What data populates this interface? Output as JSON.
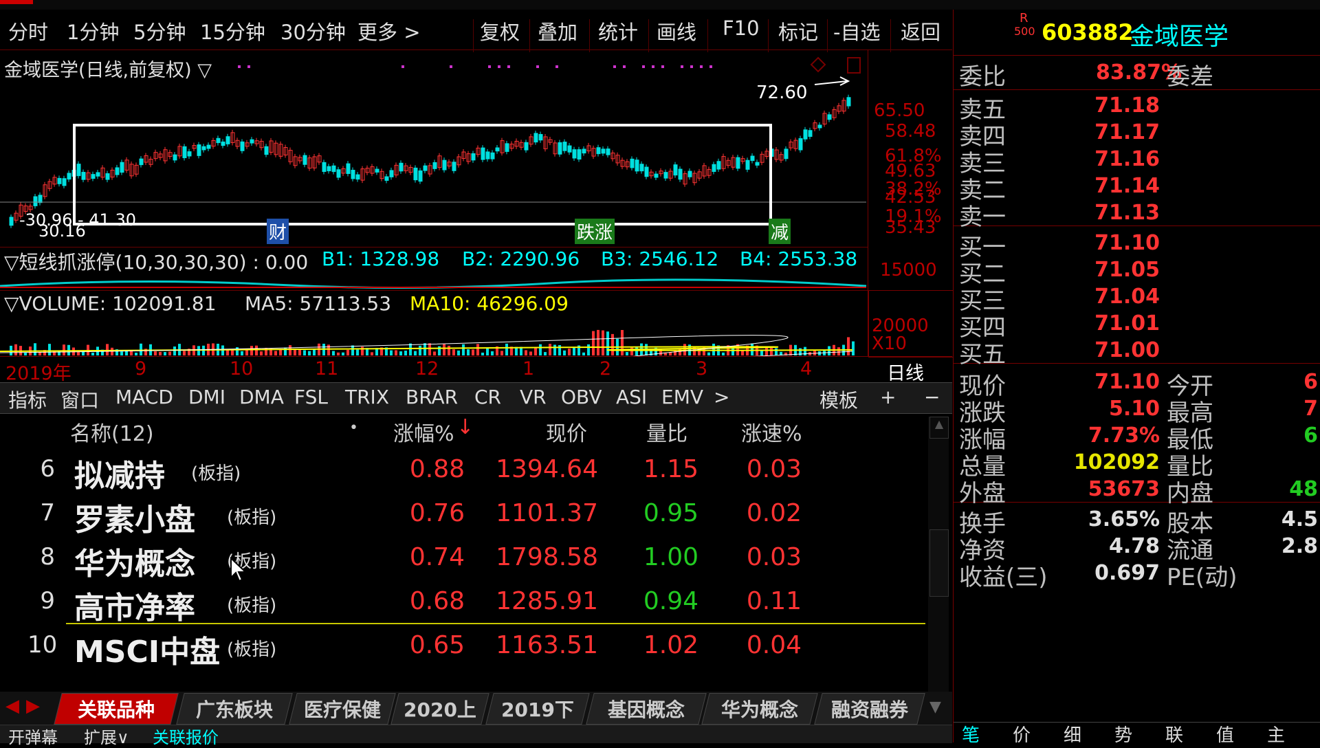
{
  "toolbar": {
    "periods": [
      "分时",
      "1分钟",
      "5分钟",
      "15分钟",
      "30分钟",
      "更多 >"
    ],
    "actions": [
      "复权",
      "叠加",
      "统计",
      "画线",
      "F10",
      "标记",
      "-自选",
      "返回"
    ]
  },
  "stock": {
    "badge_top": "R",
    "badge_bottom": "500",
    "code": "603882",
    "name": "金域医学"
  },
  "chart": {
    "title": "金域医学(日线,前复权) ▽",
    "high_label": "72.60",
    "low_label": "-30.96 - 41.30",
    "low_sub": "30.16",
    "price_axis": [
      "65.50",
      "58.48",
      "61.8%",
      "49.63",
      "38.2%",
      "42.53",
      "19.1%",
      "35.43"
    ],
    "markers": [
      {
        "text": "财",
        "color": "#1e4fa8"
      },
      {
        "text": "跌涨",
        "color": "#1a7a1a"
      },
      {
        "text": "减",
        "color": "#1a7a1a"
      }
    ]
  },
  "indicator1": {
    "name": "▽短线抓涨停(10,30,30,30) : 0.00",
    "b1": "B1: 1328.98",
    "b2": "B2: 2290.96",
    "b3": "B3: 2546.12",
    "b4": "B4: 2553.38",
    "axis": "15000"
  },
  "volume": {
    "label": "▽VOLUME: 102091.81",
    "ma5": "MA5: 57113.53",
    "ma10": "MA10: 46296.09",
    "axis": "20000",
    "axis_unit": "X10"
  },
  "date_axis": {
    "labels": [
      "2019年",
      "9",
      "10",
      "11",
      "12",
      "1",
      "2",
      "3",
      "4"
    ],
    "period": "日线"
  },
  "indicator_tabs": [
    "指标",
    "窗口",
    "MACD",
    "DMI",
    "DMA",
    "FSL",
    "TRIX",
    "BRAR",
    "CR",
    "VR",
    "OBV",
    "ASI",
    "EMV",
    ">"
  ],
  "indicator_tab_right": [
    "模板",
    "+",
    "−"
  ],
  "list": {
    "headers": {
      "name": "名称(12)",
      "dot": "•",
      "change": "涨幅%",
      "price": "现价",
      "vol_ratio": "量比",
      "speed": "涨速%"
    },
    "rows": [
      {
        "idx": "6",
        "name": "拟减持",
        "tag": "(板指)",
        "change": "0.88",
        "price": "1394.64",
        "vol_ratio": "1.15",
        "vr_color": "#ff3333",
        "speed": "0.03"
      },
      {
        "idx": "7",
        "name": "罗素小盘",
        "tag": "(板指)",
        "change": "0.76",
        "price": "1101.37",
        "vol_ratio": "0.95",
        "vr_color": "#22cc22",
        "speed": "0.02"
      },
      {
        "idx": "8",
        "name": "华为概念",
        "tag": "(板指)",
        "change": "0.74",
        "price": "1798.58",
        "vol_ratio": "1.00",
        "vr_color": "#22cc22",
        "speed": "0.03"
      },
      {
        "idx": "9",
        "name": "高市净率",
        "tag": "(板指)",
        "change": "0.68",
        "price": "1285.91",
        "vol_ratio": "0.94",
        "vr_color": "#22cc22",
        "speed": "0.11"
      },
      {
        "idx": "10",
        "name": "MSCI中盘",
        "tag": "(板指)",
        "change": "0.65",
        "price": "1163.51",
        "vol_ratio": "1.02",
        "vr_color": "#ff3333",
        "speed": "0.04"
      }
    ]
  },
  "bottom_tabs": [
    "关联品种",
    "广东板块",
    "医疗保健",
    "2020上",
    "2019下",
    "基因概念",
    "华为概念",
    "融资融券"
  ],
  "footer": {
    "items": [
      "开弹幕",
      "扩展∨",
      "关联报价"
    ]
  },
  "right_panel": {
    "weibi_label": "委比",
    "weibi_value": "83.87%",
    "weicha_label": "委差",
    "asks": [
      {
        "label": "卖五",
        "price": "71.18"
      },
      {
        "label": "卖四",
        "price": "71.17"
      },
      {
        "label": "卖三",
        "price": "71.16"
      },
      {
        "label": "卖二",
        "price": "71.14"
      },
      {
        "label": "卖一",
        "price": "71.13"
      }
    ],
    "bids": [
      {
        "label": "买一",
        "price": "71.10"
      },
      {
        "label": "买二",
        "price": "71.05"
      },
      {
        "label": "买三",
        "price": "71.04"
      },
      {
        "label": "买四",
        "price": "71.01"
      },
      {
        "label": "买五",
        "price": "71.00"
      }
    ],
    "quote": [
      {
        "label": "现价",
        "value": "71.10",
        "color": "#ff3333",
        "label2": "今开",
        "value2": "6",
        "color2": "#ff3333"
      },
      {
        "label": "涨跌",
        "value": "5.10",
        "color": "#ff3333",
        "label2": "最高",
        "value2": "7",
        "color2": "#ff3333"
      },
      {
        "label": "涨幅",
        "value": "7.73%",
        "color": "#ff3333",
        "label2": "最低",
        "value2": "6",
        "color2": "#22cc22"
      },
      {
        "label": "总量",
        "value": "102092",
        "color": "#e6e600",
        "label2": "量比",
        "value2": "",
        "color2": "#ff3333"
      },
      {
        "label": "外盘",
        "value": "53673",
        "color": "#ff3333",
        "label2": "内盘",
        "value2": "48",
        "color2": "#22cc22"
      }
    ],
    "fund": [
      {
        "label": "换手",
        "value": "3.65%",
        "label2": "股本",
        "value2": "4.5"
      },
      {
        "label": "净资",
        "value": "4.78",
        "label2": "流通",
        "value2": "2.8"
      },
      {
        "label": "收益(三)",
        "value": "0.697",
        "label2": "PE(动)",
        "value2": ""
      }
    ],
    "bottom_tabs": [
      "笔",
      "价",
      "细",
      "势",
      "联",
      "值",
      "主"
    ]
  },
  "colors": {
    "up": "#ff3333",
    "down": "#22cc22",
    "accent": "#00ffff",
    "border": "#880000"
  }
}
